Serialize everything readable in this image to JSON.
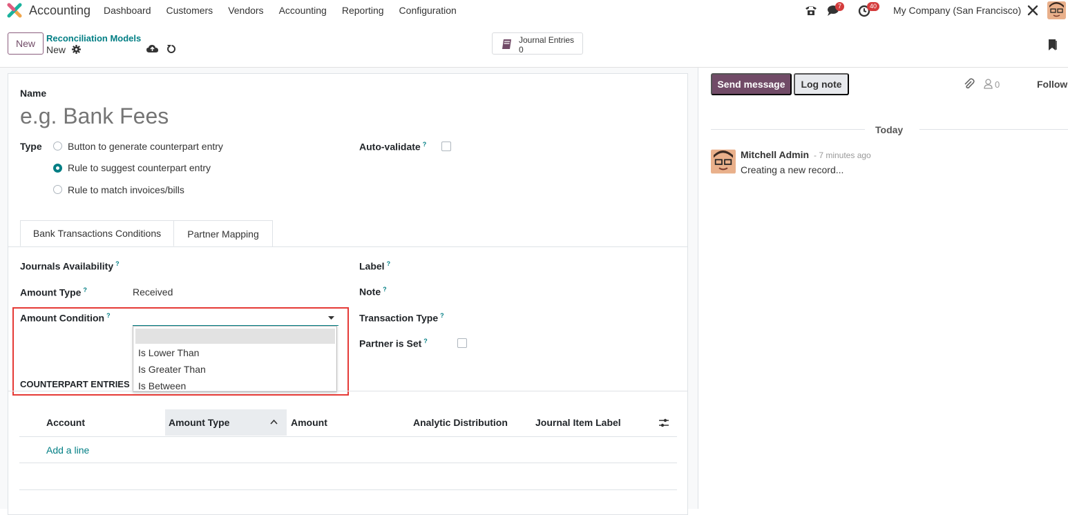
{
  "navbar": {
    "app_name": "Accounting",
    "menu": [
      "Dashboard",
      "Customers",
      "Vendors",
      "Accounting",
      "Reporting",
      "Configuration"
    ],
    "messages_badge": "7",
    "activities_badge": "40",
    "company": "My Company (San Francisco)"
  },
  "control_panel": {
    "new_button": "New",
    "breadcrumb_parent": "Reconciliation Models",
    "breadcrumb_current": "New",
    "smart_button": {
      "label": "Journal Entries",
      "value": "0"
    }
  },
  "form": {
    "name_label": "Name",
    "name_placeholder": "e.g. Bank Fees",
    "type_label": "Type",
    "type_options": [
      {
        "label": "Button to generate counterpart entry",
        "selected": false
      },
      {
        "label": "Rule to suggest counterpart entry",
        "selected": true
      },
      {
        "label": "Rule to match invoices/bills",
        "selected": false
      }
    ],
    "auto_validate_label": "Auto-validate",
    "help_mark": "?",
    "tabs": [
      "Bank Transactions Conditions",
      "Partner Mapping"
    ],
    "journals_availability_label": "Journals Availability",
    "amount_type_label": "Amount Type",
    "amount_type_value": "Received",
    "amount_condition_label": "Amount Condition",
    "amount_condition_options": [
      "",
      "Is Lower Than",
      "Is Greater Than",
      "Is Between"
    ],
    "label_label": "Label",
    "note_label": "Note",
    "transaction_type_label": "Transaction Type",
    "partner_is_set_label": "Partner is Set",
    "counterpart_section": "COUNTERPART ENTRIES",
    "table_headers": [
      "Account",
      "Amount Type",
      "Amount",
      "Analytic Distribution",
      "Journal Item Label"
    ],
    "add_line": "Add a line"
  },
  "chatter": {
    "send_message": "Send message",
    "log_note": "Log note",
    "follower_count": "0",
    "follow": "Follow",
    "date_separator": "Today",
    "message": {
      "author": "Mitchell Admin",
      "time": "- 7 minutes ago",
      "body": "Creating a new record..."
    }
  },
  "colors": {
    "primary": "#714b67",
    "link": "#017e84",
    "highlight": "#e53935"
  }
}
